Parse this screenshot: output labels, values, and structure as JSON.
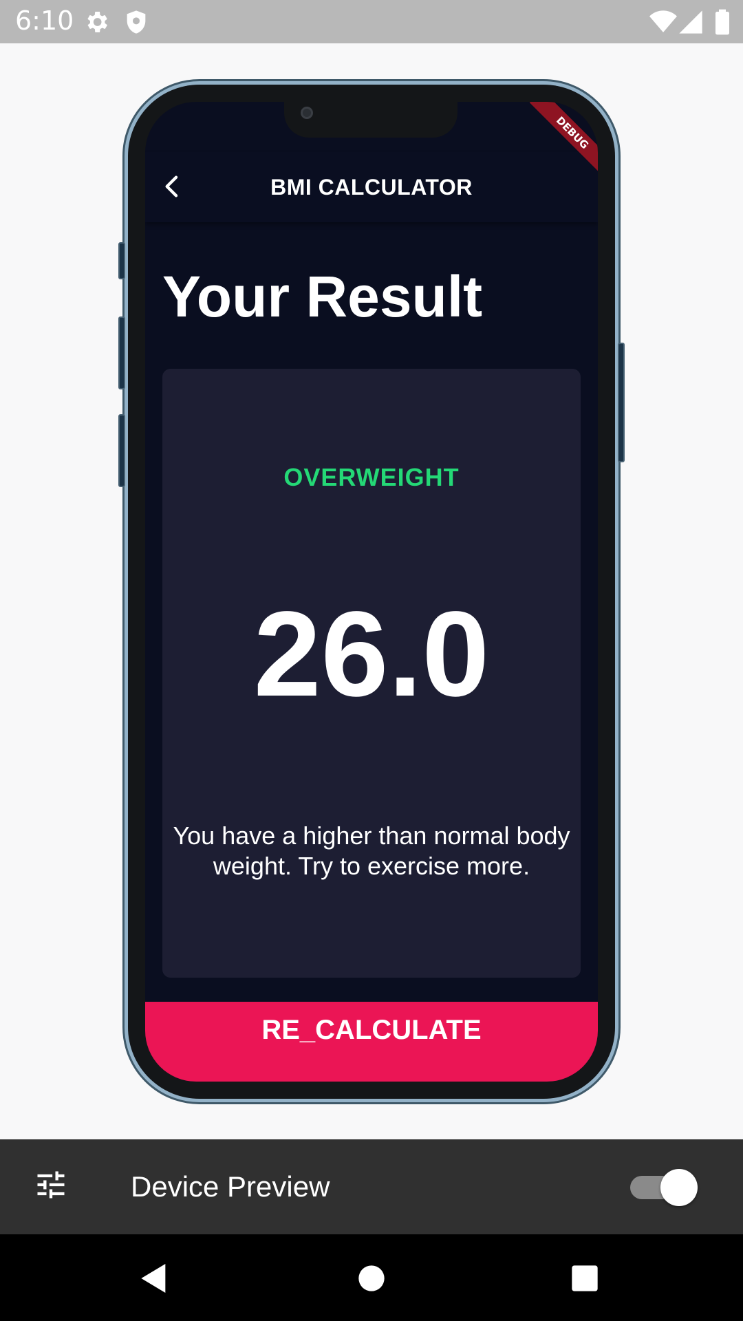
{
  "status_bar": {
    "time": "6:10",
    "icons": [
      "gear-icon",
      "shield-icon",
      "wifi-icon",
      "signal-icon",
      "battery-icon"
    ]
  },
  "device": {
    "debug_banner": "DEBUG"
  },
  "app": {
    "app_bar_title": "BMI CALCULATOR",
    "back_icon": "chevron-left-icon",
    "heading": "Your Result",
    "result": {
      "status": "OVERWEIGHT",
      "bmi": "26.0",
      "advice": "You have a higher than normal body weight. Try to exercise more."
    },
    "recalculate_label": "RE_CALCULATE"
  },
  "device_preview_toolbar": {
    "settings_icon": "tune-icon",
    "label": "Device Preview",
    "toggle_on": true
  },
  "nav_bar": {
    "buttons": [
      "back-icon",
      "home-icon",
      "recents-icon"
    ]
  },
  "colors": {
    "background": "#0a0e21",
    "card": "#1d1e33",
    "accent": "#eb1555",
    "status_green": "#24d876"
  }
}
